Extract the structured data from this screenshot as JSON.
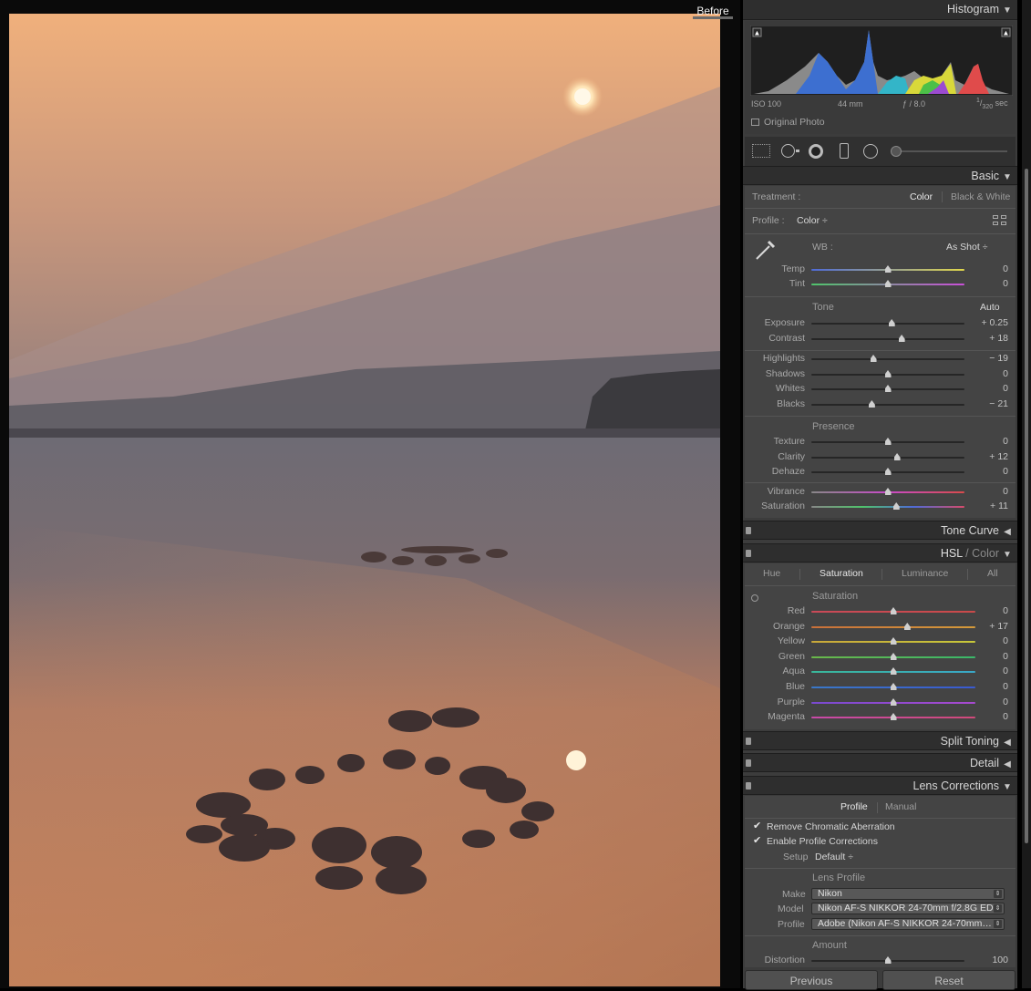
{
  "viewer": {
    "before_label": "Before"
  },
  "histogram": {
    "title": "Histogram",
    "iso": "ISO 100",
    "focal": "44 mm",
    "aperture": "ƒ / 8.0",
    "shutter_num": "1",
    "shutter_den": "320",
    "shutter_unit": "sec",
    "original_photo": "Original Photo"
  },
  "basic": {
    "title": "Basic",
    "treatment_label": "Treatment :",
    "treatment_color": "Color",
    "treatment_bw": "Black & White",
    "profile_label": "Profile :",
    "profile_value": "Color",
    "wb_label": "WB :",
    "wb_value": "As Shot",
    "temp": {
      "label": "Temp",
      "value": "0",
      "pos": 0.5
    },
    "tint": {
      "label": "Tint",
      "value": "0",
      "pos": 0.5
    },
    "tone_label": "Tone",
    "auto": "Auto",
    "exposure": {
      "label": "Exposure",
      "value": "+ 0.25",
      "pos": 0.525
    },
    "contrast": {
      "label": "Contrast",
      "value": "+ 18",
      "pos": 0.59
    },
    "highlights": {
      "label": "Highlights",
      "value": "− 19",
      "pos": 0.405
    },
    "shadows": {
      "label": "Shadows",
      "value": "0",
      "pos": 0.5
    },
    "whites": {
      "label": "Whites",
      "value": "0",
      "pos": 0.5
    },
    "blacks": {
      "label": "Blacks",
      "value": "− 21",
      "pos": 0.395
    },
    "presence_label": "Presence",
    "texture": {
      "label": "Texture",
      "value": "0",
      "pos": 0.5
    },
    "clarity": {
      "label": "Clarity",
      "value": "+ 12",
      "pos": 0.56
    },
    "dehaze": {
      "label": "Dehaze",
      "value": "0",
      "pos": 0.5
    },
    "vibrance": {
      "label": "Vibrance",
      "value": "0",
      "pos": 0.5
    },
    "saturation": {
      "label": "Saturation",
      "value": "+ 11",
      "pos": 0.555
    }
  },
  "tone_curve": {
    "title": "Tone Curve"
  },
  "hsl": {
    "title_a": "HSL",
    "title_b": " / Color",
    "tabs": [
      "Hue",
      "Saturation",
      "Luminance",
      "All"
    ],
    "sub": "Saturation",
    "red": {
      "label": "Red",
      "value": "0",
      "pos": 0.5
    },
    "orange": {
      "label": "Orange",
      "value": "+ 17",
      "pos": 0.585
    },
    "yellow": {
      "label": "Yellow",
      "value": "0",
      "pos": 0.5
    },
    "green": {
      "label": "Green",
      "value": "0",
      "pos": 0.5
    },
    "aqua": {
      "label": "Aqua",
      "value": "0",
      "pos": 0.5
    },
    "blue": {
      "label": "Blue",
      "value": "0",
      "pos": 0.5
    },
    "purple": {
      "label": "Purple",
      "value": "0",
      "pos": 0.5
    },
    "magenta": {
      "label": "Magenta",
      "value": "0",
      "pos": 0.5
    }
  },
  "split_toning": {
    "title": "Split Toning"
  },
  "detail": {
    "title": "Detail"
  },
  "lens": {
    "title": "Lens Corrections",
    "tab_profile": "Profile",
    "tab_manual": "Manual",
    "remove_ca": "Remove Chromatic Aberration",
    "enable_profile": "Enable Profile Corrections",
    "setup_label": "Setup",
    "setup_value": "Default",
    "lens_profile_label": "Lens Profile",
    "make_label": "Make",
    "make_value": "Nikon",
    "model_label": "Model",
    "model_value": "Nikon AF-S NIKKOR 24-70mm f/2.8G ED",
    "profile_label": "Profile",
    "profile_value": "Adobe (Nikon AF-S NIKKOR 24-70mm…",
    "amount_label": "Amount",
    "distortion": {
      "label": "Distortion",
      "value": "100",
      "pos": 0.5
    }
  },
  "buttons": {
    "previous": "Previous",
    "reset": "Reset"
  }
}
